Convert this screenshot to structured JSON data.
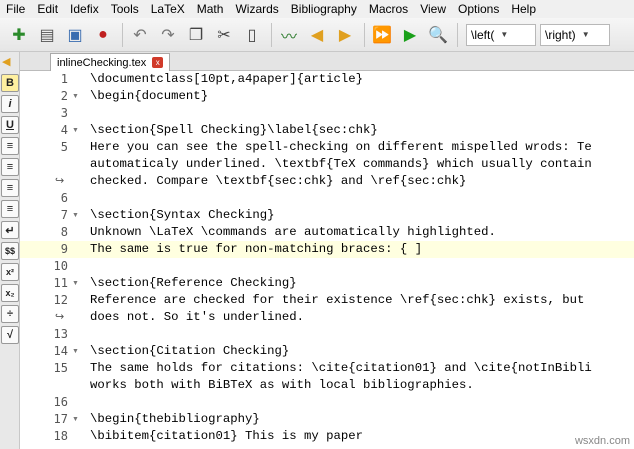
{
  "menu": [
    "File",
    "Edit",
    "Idefix",
    "Tools",
    "LaTeX",
    "Math",
    "Wizards",
    "Bibliography",
    "Macros",
    "View",
    "Options",
    "Help"
  ],
  "toolbar": {
    "left_combo": "\\left(",
    "right_combo": "\\right)"
  },
  "tab": {
    "filename": "inlineChecking.tex",
    "close": "x"
  },
  "sidebar": [
    "B",
    "i",
    "U",
    "≡",
    "≡",
    "≡",
    "≡",
    "↵",
    "$$",
    "x²",
    "x₂",
    "÷",
    "√"
  ],
  "watermark": "wsxdn.com",
  "lines": [
    {
      "n": "1",
      "t": "\\documentclass[10pt,a4paper]{article}"
    },
    {
      "n": "2",
      "t": "\\begin{document}"
    },
    {
      "n": "3",
      "t": ""
    },
    {
      "n": "4",
      "t": "\\section{Spell Checking}\\label{sec:chk}"
    },
    {
      "n": "5",
      "t": "Here you can see the spell-checking on different mispelled wrods: Te"
    },
    {
      "n": "",
      "t": "automaticaly underlined. \\textbf{TeX commands} which usually contain"
    },
    {
      "n": "",
      "t": "checked. Compare \\textbf{sec:chk} and \\ref{sec:chk}"
    },
    {
      "n": "6",
      "t": ""
    },
    {
      "n": "7",
      "t": "\\section{Syntax Checking}"
    },
    {
      "n": "8",
      "t": "Unknown \\LaTeX \\commands are automatically highlighted."
    },
    {
      "n": "9",
      "t": "The same is true for non-matching braces: { ]"
    },
    {
      "n": "10",
      "t": ""
    },
    {
      "n": "11",
      "t": "\\section{Reference Checking}"
    },
    {
      "n": "12",
      "t": "Reference are checked for their existence \\ref{sec:chk} exists, but"
    },
    {
      "n": "",
      "t": "does not. So it's underlined."
    },
    {
      "n": "13",
      "t": ""
    },
    {
      "n": "14",
      "t": "\\section{Citation Checking}"
    },
    {
      "n": "15",
      "t": "The same holds for citations: \\cite{citation01} and \\cite{notInBibli"
    },
    {
      "n": "",
      "t": "works both with BiBTeX as with local bibliographies."
    },
    {
      "n": "16",
      "t": ""
    },
    {
      "n": "17",
      "t": "\\begin{thebibliography}"
    },
    {
      "n": "18",
      "t": "\\bibitem{citation01} This is my paper"
    }
  ]
}
